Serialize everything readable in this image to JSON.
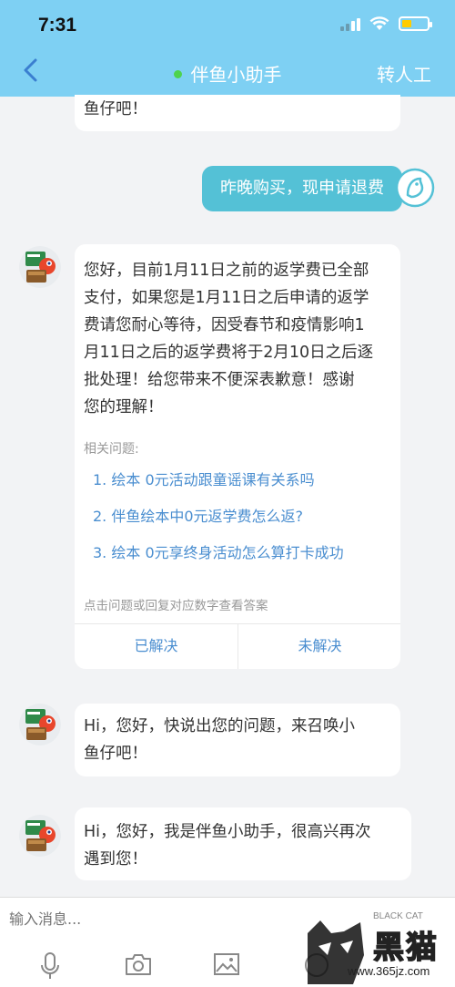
{
  "status_bar": {
    "time": "7:31"
  },
  "header": {
    "title": "伴鱼小助手",
    "human_button": "转人工",
    "bg_color": "#7ed0f3"
  },
  "messages": {
    "top_partial": "鱼仔吧！",
    "user_message": "昨晚购买，现申请退费",
    "bot_answer": {
      "lines": [
        "您好，目前1月11日之前的返学费已全部",
        "支付，如果您是1月11日之后申请的返学",
        "费请您耐心等待，因受春节和疫情影响1",
        "月11日之后的返学费将于2月10日之后逐",
        "批处理！给您带来不便深表歉意！感谢",
        "您的理解！"
      ],
      "related_title": "相关问题:",
      "related_questions": [
        "1. 绘本 0元活动跟童谣课有关系吗",
        "2. 伴鱼绘本中0元返学费怎么返?",
        "3. 绘本 0元享终身活动怎么算打卡成功"
      ],
      "hint": "点击问题或回复对应数字查看答案",
      "solved_label": "已解决",
      "unsolved_label": "未解决"
    },
    "bot_greeting_1": [
      "Hi，您好，快说出您的问题，来召唤小",
      "鱼仔吧！"
    ],
    "bot_greeting_2": [
      "Hi，您好，我是伴鱼小助手，很高兴再次",
      "遇到您！"
    ]
  },
  "input_bar": {
    "placeholder": "输入消息..."
  },
  "watermark": {
    "brand": "黑猫",
    "url": "www.365jz.com",
    "sub": "BLACK CAT"
  },
  "colors": {
    "accent_link": "#4a8ed0",
    "user_bubble": "#54c1d6",
    "online_dot": "#4ed34e"
  }
}
